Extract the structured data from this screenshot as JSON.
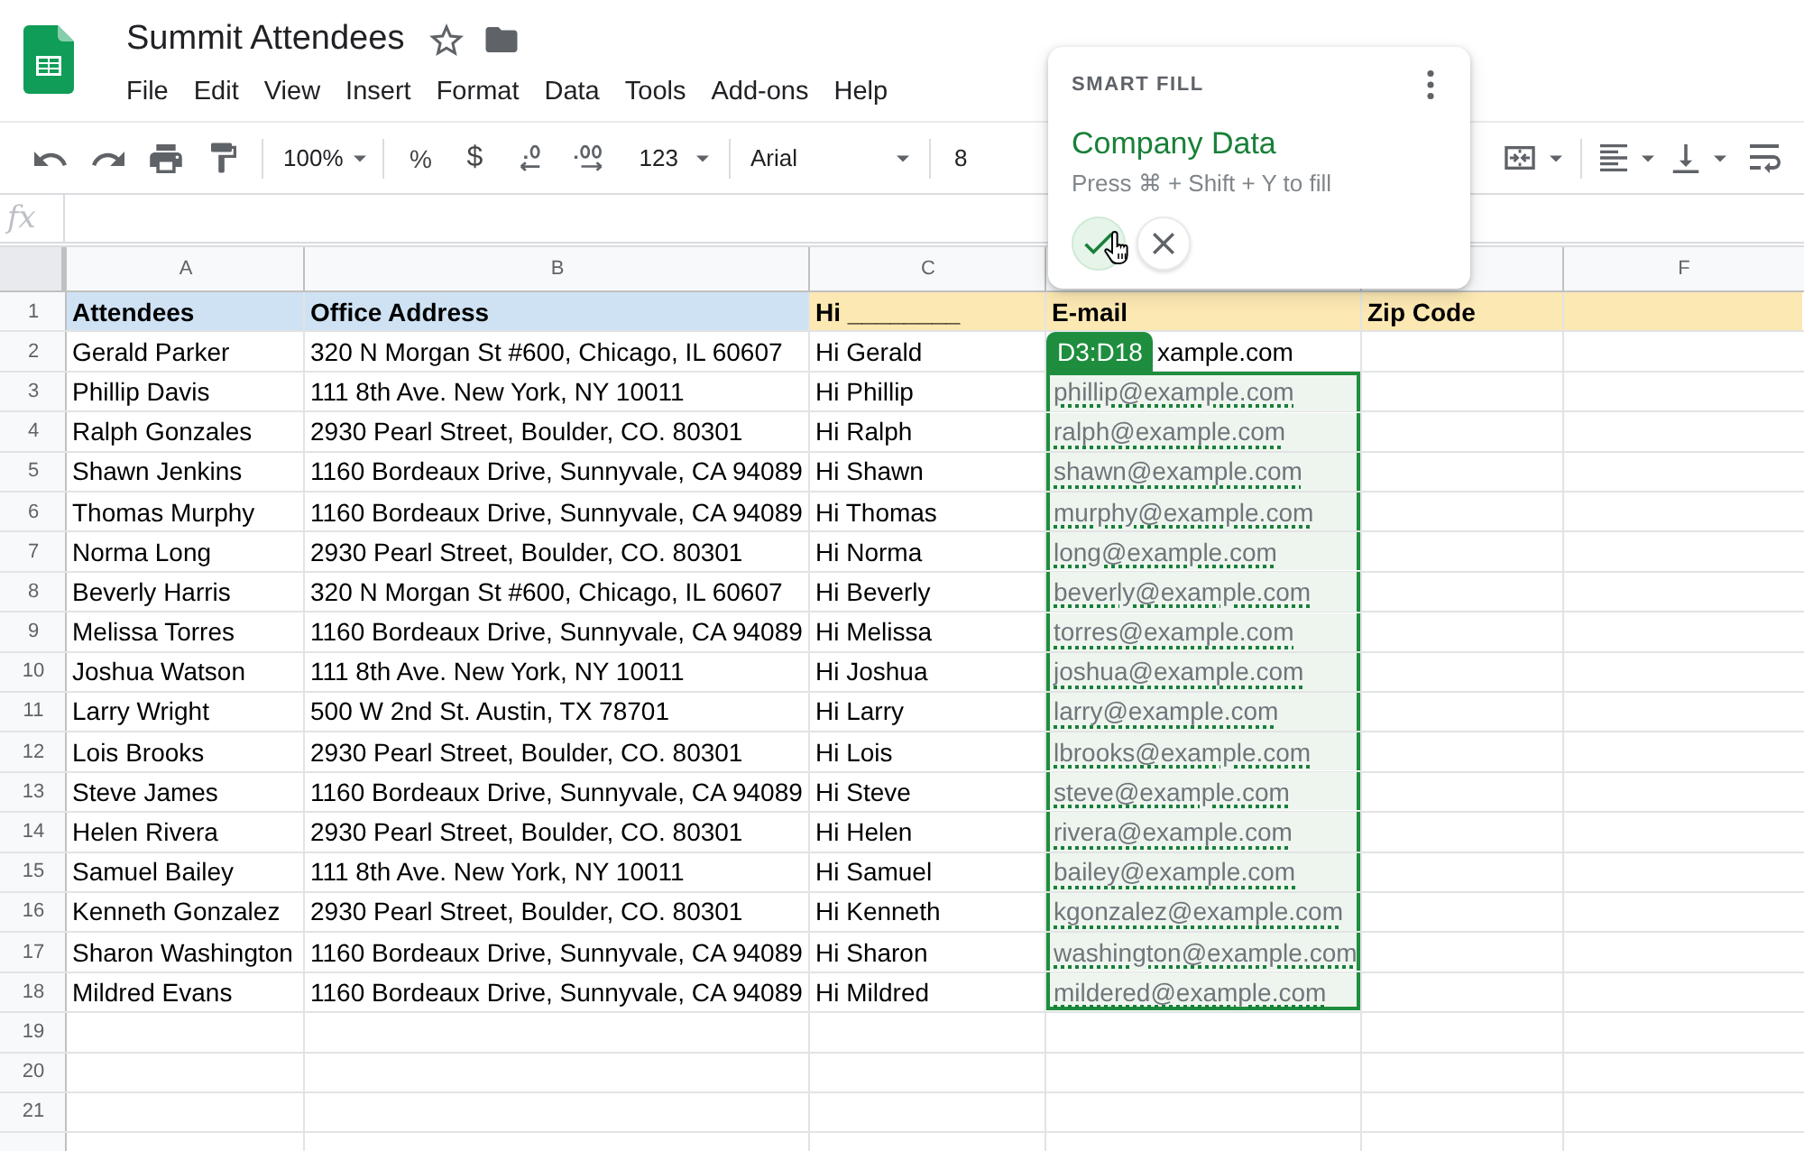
{
  "document": {
    "title": "Summit Attendees",
    "starred": false
  },
  "menu": [
    "File",
    "Edit",
    "View",
    "Insert",
    "Format",
    "Data",
    "Tools",
    "Add-ons",
    "Help"
  ],
  "toolbar": {
    "zoom": "100%",
    "percent": "%",
    "currency": "$",
    "number_format": "123",
    "font": "Arial",
    "font_size": "8"
  },
  "formula_bar": {
    "label": "fx"
  },
  "columns": [
    {
      "header": "A"
    },
    {
      "header": "B"
    },
    {
      "header": "C"
    },
    {},
    {},
    {
      "header": "F"
    }
  ],
  "rows": [
    {
      "number": "1",
      "cells": [
        {
          "text": "Attendees",
          "kind": "header",
          "color": "#cfe2f3"
        },
        {
          "text": "Office Address",
          "kind": "header",
          "color": "#cfe2f3"
        },
        {
          "text": "Hi ________",
          "kind": "header",
          "color": "#fce8b2"
        },
        {
          "text": "E-mail",
          "kind": "header",
          "color": "#fce8b2"
        },
        {
          "text": "Zip Code",
          "kind": "header",
          "color": "#fce8b2"
        },
        {
          "kind": "header",
          "color": "#fce8b2"
        }
      ]
    },
    {
      "number": "2",
      "cells": [
        {
          "text": "Gerald Parker",
          "kind": "text"
        },
        {
          "text": "320 N Morgan St #600, Chicago, IL 60607",
          "kind": "text"
        },
        {
          "text": "Hi Gerald",
          "kind": "text"
        },
        {
          "text": "xample.com",
          "kind": "text"
        }
      ]
    },
    {
      "number": "3",
      "cells": [
        {
          "text": "Phillip Davis",
          "kind": "text"
        },
        {
          "text": "111 8th Ave. New York, NY 10011",
          "kind": "text"
        },
        {
          "text": "Hi Phillip",
          "kind": "text"
        },
        {
          "text": "phillip@example.com",
          "kind": "suggestion"
        }
      ]
    },
    {
      "number": "4",
      "cells": [
        {
          "text": "Ralph Gonzales",
          "kind": "text"
        },
        {
          "text": "2930 Pearl Street, Boulder, CO. 80301",
          "kind": "text"
        },
        {
          "text": "Hi Ralph",
          "kind": "text"
        },
        {
          "text": "ralph@example.com",
          "kind": "suggestion"
        }
      ]
    },
    {
      "number": "5",
      "cells": [
        {
          "text": "Shawn Jenkins",
          "kind": "text"
        },
        {
          "text": "1160 Bordeaux Drive, Sunnyvale, CA 94089",
          "kind": "text"
        },
        {
          "text": "Hi Shawn",
          "kind": "text"
        },
        {
          "text": "shawn@example.com",
          "kind": "suggestion"
        }
      ]
    },
    {
      "number": "6",
      "cells": [
        {
          "text": "Thomas Murphy",
          "kind": "text"
        },
        {
          "text": "1160 Bordeaux Drive, Sunnyvale, CA 94089",
          "kind": "text"
        },
        {
          "text": "Hi Thomas",
          "kind": "text"
        },
        {
          "text": "murphy@example.com",
          "kind": "suggestion"
        }
      ]
    },
    {
      "number": "7",
      "cells": [
        {
          "text": "Norma Long",
          "kind": "text"
        },
        {
          "text": "2930 Pearl Street, Boulder, CO. 80301",
          "kind": "text"
        },
        {
          "text": "Hi Norma",
          "kind": "text"
        },
        {
          "text": "long@example.com",
          "kind": "suggestion"
        }
      ]
    },
    {
      "number": "8",
      "cells": [
        {
          "text": "Beverly Harris",
          "kind": "text"
        },
        {
          "text": "320 N Morgan St #600, Chicago, IL 60607",
          "kind": "text"
        },
        {
          "text": "Hi Beverly",
          "kind": "text"
        },
        {
          "text": "beverly@example.com",
          "kind": "suggestion"
        }
      ]
    },
    {
      "number": "9",
      "cells": [
        {
          "text": "Melissa Torres",
          "kind": "text"
        },
        {
          "text": "1160 Bordeaux Drive, Sunnyvale, CA 94089",
          "kind": "text"
        },
        {
          "text": "Hi Melissa",
          "kind": "text"
        },
        {
          "text": "torres@example.com",
          "kind": "suggestion"
        }
      ]
    },
    {
      "number": "10",
      "cells": [
        {
          "text": "Joshua Watson",
          "kind": "text"
        },
        {
          "text": "111 8th Ave. New York, NY 10011",
          "kind": "text"
        },
        {
          "text": "Hi Joshua",
          "kind": "text"
        },
        {
          "text": "joshua@example.com",
          "kind": "suggestion"
        }
      ]
    },
    {
      "number": "11",
      "cells": [
        {
          "text": "Larry Wright",
          "kind": "text"
        },
        {
          "text": "500 W 2nd St. Austin, TX 78701",
          "kind": "text"
        },
        {
          "text": "Hi Larry",
          "kind": "text"
        },
        {
          "text": "larry@example.com",
          "kind": "suggestion"
        }
      ]
    },
    {
      "number": "12",
      "cells": [
        {
          "text": "Lois Brooks",
          "kind": "text"
        },
        {
          "text": "2930 Pearl Street, Boulder, CO. 80301",
          "kind": "text"
        },
        {
          "text": "Hi Lois",
          "kind": "text"
        },
        {
          "text": "lbrooks@example.com",
          "kind": "suggestion"
        }
      ]
    },
    {
      "number": "13",
      "cells": [
        {
          "text": "Steve James",
          "kind": "text"
        },
        {
          "text": "1160 Bordeaux Drive, Sunnyvale, CA 94089",
          "kind": "text"
        },
        {
          "text": "Hi Steve",
          "kind": "text"
        },
        {
          "text": "steve@example.com",
          "kind": "suggestion"
        }
      ]
    },
    {
      "number": "14",
      "cells": [
        {
          "text": "Helen Rivera",
          "kind": "text"
        },
        {
          "text": "2930 Pearl Street, Boulder, CO. 80301",
          "kind": "text"
        },
        {
          "text": "Hi Helen",
          "kind": "text"
        },
        {
          "text": "rivera@example.com",
          "kind": "suggestion"
        }
      ]
    },
    {
      "number": "15",
      "cells": [
        {
          "text": "Samuel Bailey",
          "kind": "text"
        },
        {
          "text": "111 8th Ave. New York, NY 10011",
          "kind": "text"
        },
        {
          "text": "Hi Samuel",
          "kind": "text"
        },
        {
          "text": "bailey@example.com",
          "kind": "suggestion"
        }
      ]
    },
    {
      "number": "16",
      "cells": [
        {
          "text": "Kenneth Gonzalez",
          "kind": "text"
        },
        {
          "text": "2930 Pearl Street, Boulder, CO. 80301",
          "kind": "text"
        },
        {
          "text": "Hi Kenneth",
          "kind": "text"
        },
        {
          "text": "kgonzalez@example.com",
          "kind": "suggestion"
        }
      ]
    },
    {
      "number": "17",
      "cells": [
        {
          "text": "Sharon Washington",
          "kind": "text"
        },
        {
          "text": "1160 Bordeaux Drive, Sunnyvale, CA 94089",
          "kind": "text"
        },
        {
          "text": "Hi Sharon",
          "kind": "text"
        },
        {
          "text": "washington@example.com",
          "kind": "suggestion"
        }
      ]
    },
    {
      "number": "18",
      "cells": [
        {
          "text": "Mildred Evans",
          "kind": "text"
        },
        {
          "text": "1160 Bordeaux Drive, Sunnyvale, CA 94089",
          "kind": "text"
        },
        {
          "text": "Hi Mildred",
          "kind": "text"
        },
        {
          "text": "mildered@example.com",
          "kind": "suggestion"
        }
      ]
    },
    {
      "number": "19"
    },
    {
      "number": "20"
    },
    {
      "number": "21"
    }
  ],
  "selection": {
    "label": "D3:D18"
  },
  "smart_fill": {
    "title": "SMART FILL",
    "source": "Company Data",
    "hint": "Press ⌘ + Shift + Y to fill"
  }
}
